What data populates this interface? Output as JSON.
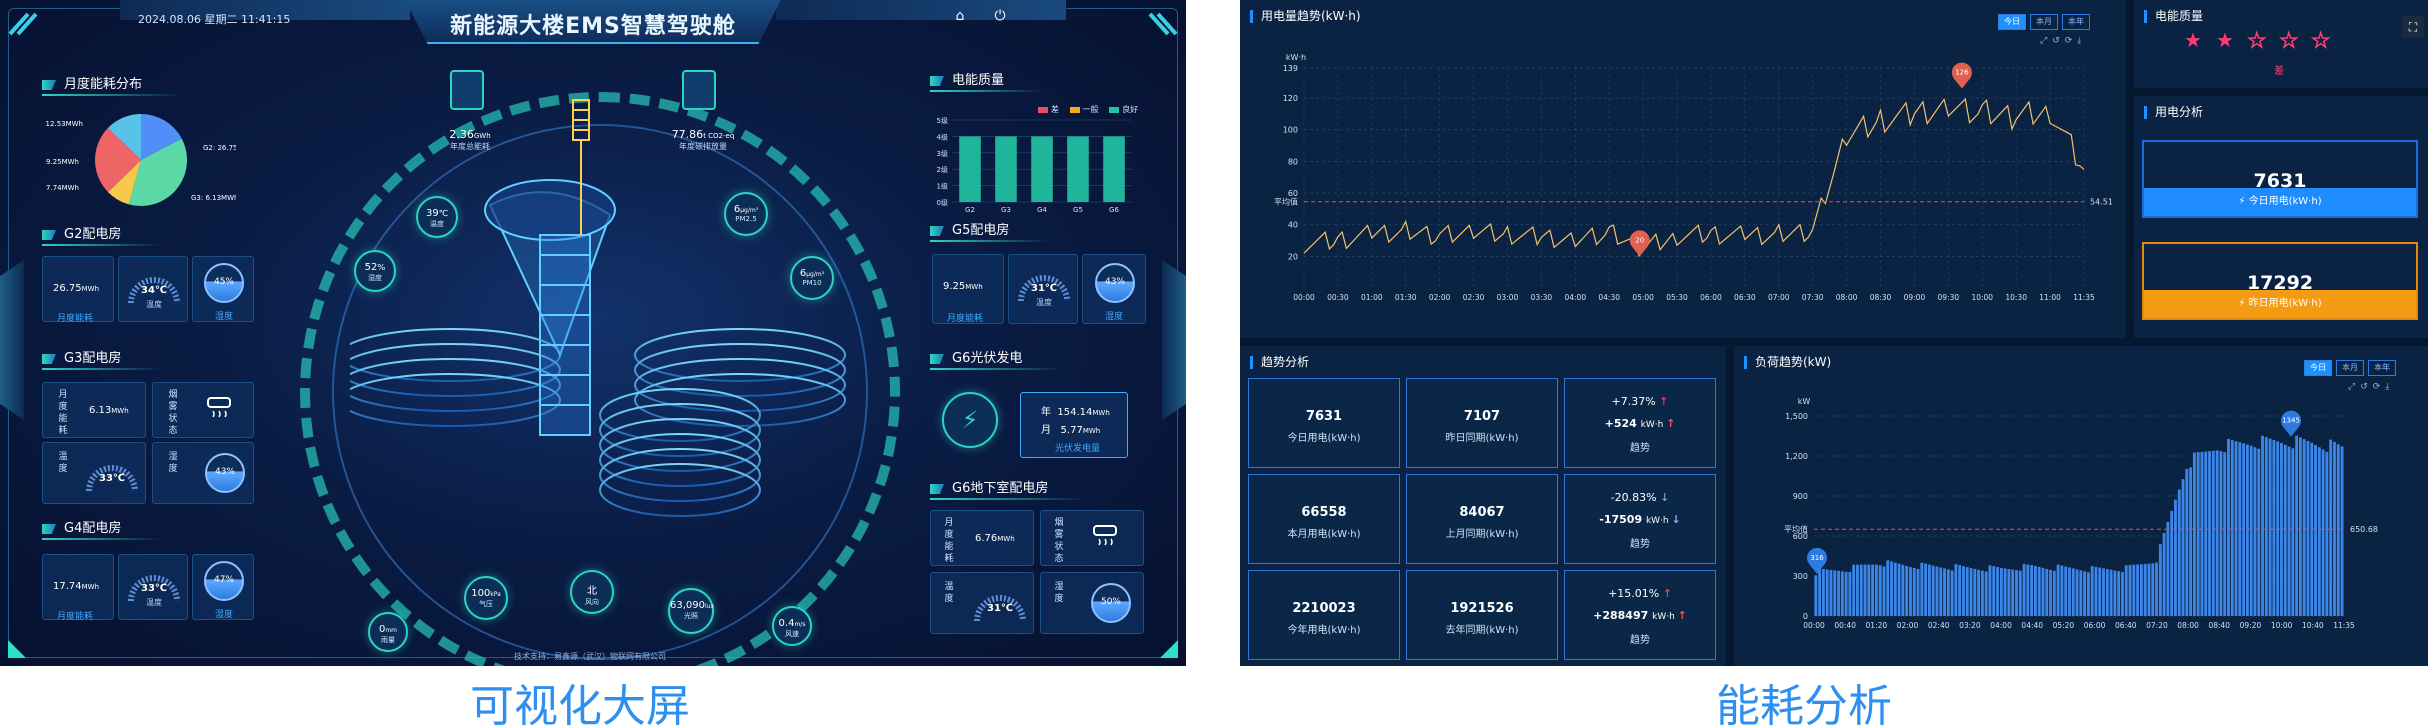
{
  "screen": {
    "datetime": "2024.08.06 星期二 11:41:15",
    "title": "新能源大楼EMS智慧驾驶舱",
    "home_icon": "home-icon",
    "exit_icon": "power-icon",
    "center_metric1": {
      "value": "2.36",
      "unit": "GWh",
      "label": "年度总能耗"
    },
    "center_metric2": {
      "value": "77.86",
      "unit": "t CO2-eq",
      "label": "年度碳排放量"
    },
    "badges": [
      {
        "value": "39",
        "unit": "℃",
        "label": "温度"
      },
      {
        "value": "52",
        "unit": "%",
        "label": "湿度"
      },
      {
        "value": "6",
        "unit": "μg/m³",
        "label": "PM2.5"
      },
      {
        "value": "6",
        "unit": "μg/m³",
        "label": "PM10"
      },
      {
        "value": "100",
        "unit": "kPa",
        "label": "气压"
      },
      {
        "value": "北",
        "unit": "",
        "label": "风向"
      },
      {
        "value": "63,090",
        "unit": "lux",
        "label": "光照"
      },
      {
        "value": "0.4",
        "unit": "m/s",
        "label": "风速"
      },
      {
        "value": "0",
        "unit": "mm",
        "label": "雨量"
      }
    ],
    "footer": "技术支持：易鑫源（武汉）物联网有限公司",
    "monthly": {
      "title": "月度能耗分布",
      "slices": [
        {
          "label": "G6: 12.53MWh",
          "value": 12.53,
          "color": "#4f8ff7"
        },
        {
          "label": "G2: 26.75MWh",
          "value": 26.75,
          "color": "#5ad8a6"
        },
        {
          "label": "G3: 6.13MWh",
          "value": 6.13,
          "color": "#f6c84c"
        },
        {
          "label": "G4: 17.74MWh",
          "value": 17.74,
          "color": "#ef6567"
        },
        {
          "label": "G5: 9.25MWh",
          "value": 9.25,
          "color": "#58c2e9"
        }
      ]
    },
    "g2": {
      "title": "G2配电房",
      "energy": "26.75",
      "unit": "MWh",
      "energy_label": "月度能耗",
      "temp": "34℃",
      "temp_label": "温度",
      "hum": "45%",
      "hum_label": "湿度"
    },
    "g3": {
      "title": "G3配电房",
      "energy_label": "月度能耗",
      "energy": "6.13",
      "unit": "MWh",
      "smoke_label": "烟雾状态",
      "temp_label": "温度",
      "temp": "33℃",
      "hum_label": "湿度",
      "hum": "43%"
    },
    "g4": {
      "title": "G4配电房",
      "energy": "17.74",
      "unit": "MWh",
      "energy_label": "月度能耗",
      "temp": "33℃",
      "temp_label": "温度",
      "hum": "47%",
      "hum_label": "湿度"
    },
    "quality": {
      "title": "电能质量",
      "legend": [
        "差",
        "一般",
        "良好"
      ],
      "legend_colors": [
        "#e84e6a",
        "#f5a623",
        "#27c29f"
      ],
      "categories": [
        "G2",
        "G3",
        "G4",
        "G5",
        "G6"
      ],
      "values": [
        4,
        4,
        4,
        4,
        4
      ],
      "yticks": [
        "5级",
        "4级",
        "3级",
        "2级",
        "1级",
        "0级"
      ]
    },
    "g5": {
      "title": "G5配电房",
      "energy": "9.25",
      "unit": "MWh",
      "energy_label": "月度能耗",
      "temp": "31℃",
      "temp_label": "温度",
      "hum": "43%",
      "hum_label": "湿度"
    },
    "g6pv": {
      "title": "G6光伏发电",
      "year_label": "年",
      "year": "154.14",
      "month_label": "月",
      "month": "5.77",
      "unit": "MWh",
      "label": "光伏发电量"
    },
    "g6b": {
      "title": "G6地下室配电房",
      "energy_label": "月度能耗",
      "energy": "6.76",
      "unit": "MWh",
      "smoke_label": "烟雾状态",
      "temp_label": "温度",
      "temp": "31℃",
      "hum_label": "湿度",
      "hum": "50%"
    }
  },
  "captions": {
    "left": "可视化大屏",
    "right": "能耗分析"
  },
  "analysis": {
    "trend": {
      "title": "用电量趋势(kW·h)",
      "unit": "kW·h",
      "tabs": [
        "今日",
        "本月",
        "本年"
      ],
      "avg_label": "平均值",
      "avg_value": "54.51",
      "max_label": "126",
      "min_label": "20",
      "x_labels": [
        "00:00",
        "00:30",
        "01:00",
        "01:30",
        "02:00",
        "02:30",
        "03:00",
        "03:30",
        "04:00",
        "04:30",
        "05:00",
        "05:30",
        "06:00",
        "06:30",
        "07:00",
        "07:30",
        "08:00",
        "08:30",
        "09:00",
        "09:30",
        "10:00",
        "10:30",
        "11:00",
        "11:35"
      ],
      "y_ticks": [
        "139",
        "120",
        "100",
        "80",
        "60",
        "40",
        "20"
      ]
    },
    "quality": {
      "title": "电能质量",
      "rating": 2,
      "label": "差"
    },
    "usage": {
      "title": "用电分析",
      "today_value": "7631",
      "today_label": "今日用电(kW·h)",
      "yday_value": "17292",
      "yday_label": "昨日用电(kW·h)"
    },
    "trends": {
      "title": "趋势分析",
      "rows": [
        {
          "a_value": "7631",
          "a_label": "今日用电(kW·h)",
          "b_value": "7107",
          "b_label": "昨日同期(kW·h)",
          "pct": "+7.37%",
          "pct_dir": "↑",
          "delta": "+524",
          "delta_unit": "kW·h",
          "delta_dir": "↑",
          "trend_label": "趋势"
        },
        {
          "a_value": "66558",
          "a_label": "本月用电(kW·h)",
          "b_value": "84067",
          "b_label": "上月同期(kW·h)",
          "pct": "-20.83%",
          "pct_dir": "↓",
          "delta": "-17509",
          "delta_unit": "kW·h",
          "delta_dir": "↓",
          "trend_label": "趋势"
        },
        {
          "a_value": "2210023",
          "a_label": "今年用电(kW·h)",
          "b_value": "1921526",
          "b_label": "去年同期(kW·h)",
          "pct": "+15.01%",
          "pct_dir": "↑",
          "delta": "+288497",
          "delta_unit": "kW·h",
          "delta_dir": "↑",
          "trend_label": "趋势"
        }
      ]
    },
    "load": {
      "title": "负荷趋势(kW)",
      "unit": "kW",
      "tabs": [
        "今日",
        "本月",
        "本年"
      ],
      "avg_label": "平均值",
      "avg_value": "650.68",
      "max_label": "1345",
      "min_label": "316",
      "x_labels": [
        "00:00",
        "00:40",
        "01:20",
        "02:00",
        "02:40",
        "03:20",
        "04:00",
        "04:40",
        "05:20",
        "06:00",
        "06:40",
        "07:20",
        "08:00",
        "08:40",
        "09:20",
        "10:00",
        "10:40",
        "11:35"
      ],
      "y_ticks": [
        "1,500",
        "1,200",
        "900",
        "600",
        "300",
        "0"
      ]
    }
  },
  "chart_data": [
    {
      "type": "line",
      "title": "用电量趋势(kW·h)",
      "ylabel": "kW·h",
      "ylim": [
        0,
        139
      ],
      "x": [
        "00:00",
        "00:30",
        "01:00",
        "01:30",
        "02:00",
        "02:30",
        "03:00",
        "03:30",
        "04:00",
        "04:30",
        "05:00",
        "05:30",
        "06:00",
        "06:30",
        "07:00",
        "07:30",
        "08:00",
        "08:30",
        "09:00",
        "09:30",
        "10:00",
        "10:30",
        "11:00",
        "11:35"
      ],
      "series": [
        {
          "values": [
            28,
            30,
            34,
            36,
            33,
            35,
            34,
            32,
            31,
            35,
            25,
            33,
            34,
            33,
            34,
            36,
            95,
            106,
            110,
            115,
            111,
            108,
            112,
            75
          ]
        }
      ],
      "avg": 54.51
    },
    {
      "type": "bar",
      "title": "负荷趋势(kW)",
      "ylabel": "kW",
      "ylim": [
        0,
        1500
      ],
      "x": [
        "00:00",
        "00:40",
        "01:20",
        "02:00",
        "02:40",
        "03:20",
        "04:00",
        "04:40",
        "05:20",
        "06:00",
        "06:40",
        "07:20",
        "08:00",
        "08:40",
        "09:20",
        "10:00",
        "10:40",
        "11:35"
      ],
      "series": [
        {
          "values": [
            330,
            350,
            400,
            380,
            370,
            360,
            355,
            370,
            360,
            350,
            355,
            420,
            1150,
            1270,
            1300,
            1310,
            1300,
            1260
          ]
        }
      ],
      "avg": 650.68
    }
  ]
}
